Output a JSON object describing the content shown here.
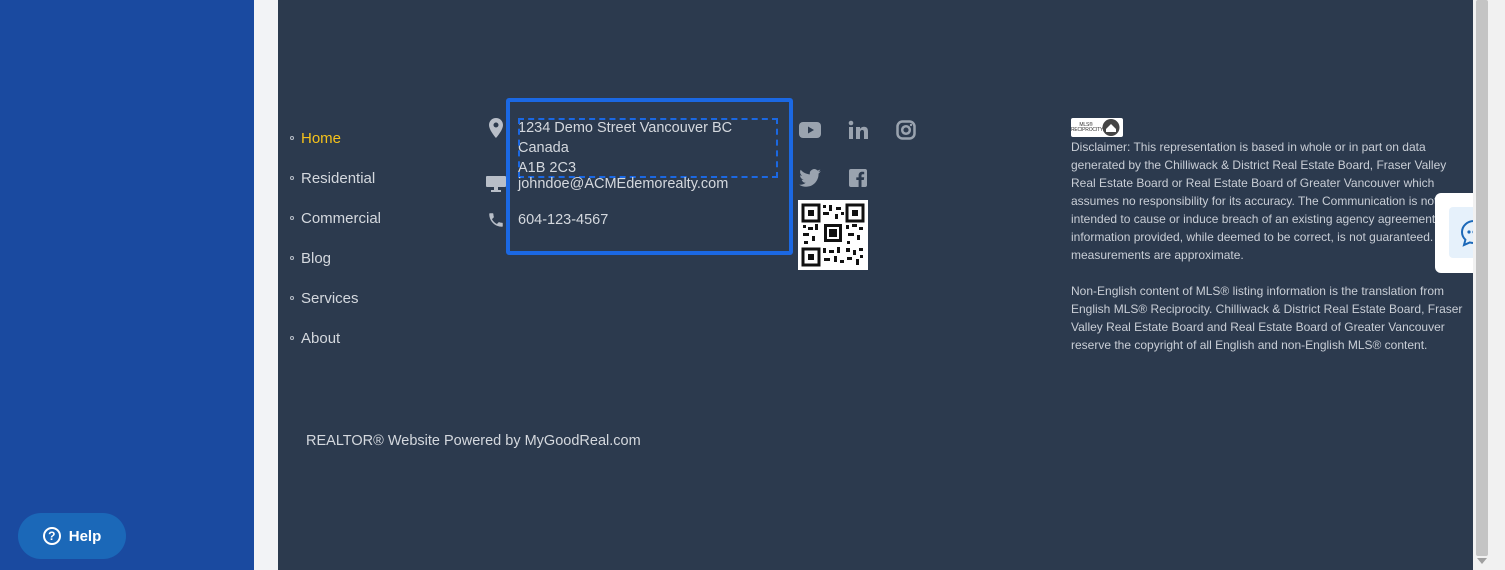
{
  "nav": {
    "items": [
      {
        "label": "Home",
        "active": true
      },
      {
        "label": "Residential"
      },
      {
        "label": "Commercial"
      },
      {
        "label": "Blog"
      },
      {
        "label": "Services"
      },
      {
        "label": "About"
      }
    ]
  },
  "contact": {
    "address_line1": "1234 Demo Street Vancouver BC Canada",
    "address_line2": "A1B 2C3",
    "email": "johndoe@ACMEdemorealty.com",
    "phone": "604-123-4567"
  },
  "social": [
    "youtube-icon",
    "linkedin-icon",
    "instagram-icon",
    "twitter-icon",
    "facebook-icon"
  ],
  "mls_logo": {
    "text": "MLS® RECIPROCITY"
  },
  "disclaimer": {
    "paragraph1": "Disclaimer: This representation is based in whole or in part on data generated by the Chilliwack & District Real Estate Board, Fraser Valley Real Estate Board or Real Estate Board of Greater Vancouver which assumes no responsibility for its accuracy. The Communication is not intended to cause or induce breach of an existing agency agreement. The information provided, while deemed to be correct, is not guaranteed. All measurements are approximate.",
    "paragraph2": "Non-English content of MLS® listing information is the translation from English MLS® Reciprocity. Chilliwack & District Real Estate Board, Fraser Valley Real Estate Board and Real Estate Board of Greater Vancouver reserve the copyright of all English and non-English MLS® content."
  },
  "powered_by": "REALTOR® Website Powered by MyGoodReal.com",
  "help": {
    "label": "Help"
  },
  "colors": {
    "accent": "#f5c21b",
    "focus": "#1b68e3",
    "footer_bg": "#2c3a4e",
    "sidebar": "#1a4aa0"
  }
}
